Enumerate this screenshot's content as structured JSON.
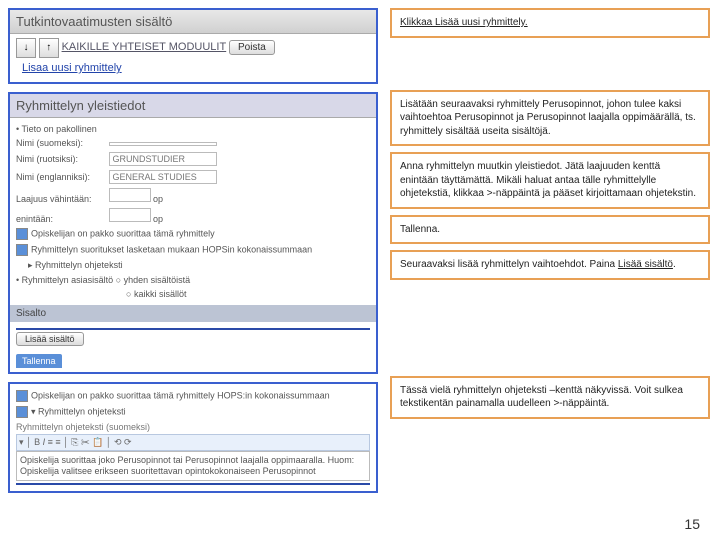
{
  "top_panel": {
    "title": "Tutkintovaatimusten sisältö",
    "module_label": "KAIKILLE YHTEISET MODUULIT",
    "remove_btn": "Poista",
    "add_grouping": "Lisaa uusi ryhmittely"
  },
  "details": {
    "header": "Ryhmittelyn yleistiedot",
    "required": "Tieto on pakollinen",
    "name_fi_label": "Nimi (suomeksi):",
    "name_fi": "",
    "name_sv_label": "Nimi (ruotsiksi):",
    "name_sv": "GRUNDSTUDIER",
    "name_en_label": "Nimi (englanniksi):",
    "name_en": "GENERAL STUDIES",
    "extent_label": "Laajuus vähintään:",
    "extent_unit": "op",
    "max_label": "enintään:",
    "max_unit": "op",
    "chk1": "Opiskelijan on pakko suorittaa tämä ryhmittely",
    "chk2": "Ryhmittelyn suoritukset lasketaan mukaan HOPSin kokonaissummaan",
    "help_label": "Ryhmittelyn ohjeteksti",
    "content_label": "Ryhmittelyn asiasisältö",
    "radio1": "yhden sisältöistä",
    "radio2": "kaikki sisällöt"
  },
  "sisalto": {
    "title": "Sisalto",
    "add_btn": "Lisää sisältö"
  },
  "action_btn": "Tallenna",
  "bottom": {
    "chk1": "Opiskelijan on pakko suorittaa tämä ryhmittely HOPS:in kokonaissummaan",
    "chk2": "Ryhmittelyn ohjeteksti",
    "editor_label": "Ryhmittelyn ohjeteksti (suomeksi)",
    "editor_text": "Opiskelija suorittaa joko Perusopinnot tai Perusopinnot laajalla oppimaaralla. Huom: Opiskelija valitsee erikseen suoritettavan opintokokonaiseen Perusopinnot"
  },
  "callouts": {
    "c1": "Klikkaa Lisää uusi ryhmittely.",
    "c2": "Lisätään seuraavaksi ryhmittely Perusopinnot, johon tulee kaksi vaihtoehtoa Perusopinnot ja Perusopinnot laajalla oppimäärällä, ts. ryhmittely sisältää useita sisältöjä.",
    "c3": "Anna ryhmittelyn muutkin yleistiedot. Jätä laajuuden kenttä enintään täyttämättä. Mikäli haluat antaa tälle ryhmittelylle ohjetekstiä, klikkaa >-näppäintä ja pääset kirjoittamaan ohjetekstin.",
    "c4": "Tallenna.",
    "c5_a": "Seuraavaksi lisää ryhmittelyn vaihtoehdot. Paina ",
    "c5_b": "Lisää sisältö",
    "c5_c": ".",
    "c6": "Tässä vielä ryhmittelyn ohjeteksti –kenttä näkyvissä. Voit sulkea tekstikentän  painamalla uudelleen >-näppäintä."
  },
  "page": "15"
}
